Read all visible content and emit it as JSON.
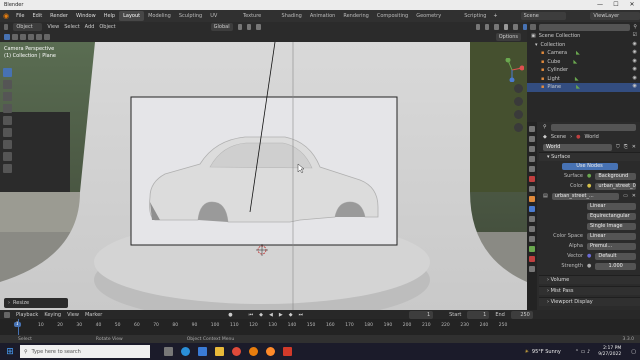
{
  "window": {
    "title": "Blender",
    "min": "—",
    "max": "☐",
    "close": "✕"
  },
  "menubar": {
    "menus": [
      "File",
      "Edit",
      "Render",
      "Window",
      "Help"
    ],
    "workspaces": [
      "Layout",
      "Modeling",
      "Sculpting",
      "UV Editing",
      "Texture Paint",
      "Shading",
      "Animation",
      "Rendering",
      "Compositing",
      "Geometry Nodes",
      "Scripting"
    ],
    "active_workspace": "Layout",
    "scene": "Scene",
    "view_layer": "ViewLayer"
  },
  "viewport_header": {
    "mode": "Object Mode",
    "menus": [
      "View",
      "Select",
      "Add",
      "Object"
    ],
    "orientation": "Global",
    "options": "Options"
  },
  "viewport": {
    "camera_label": "Camera Perspective",
    "collection_label": "(1) Collection | Plane",
    "resize_label": "Resize"
  },
  "outliner": {
    "search_placeholder": "",
    "items": [
      {
        "label": "Scene Collection",
        "color": "#cccccc"
      },
      {
        "label": "Collection",
        "color": "#cccccc"
      },
      {
        "label": "Camera",
        "color": "#e08a3c"
      },
      {
        "label": "Cube",
        "color": "#e08a3c"
      },
      {
        "label": "Cylinder",
        "color": "#e08a3c"
      },
      {
        "label": "Light",
        "color": "#e08a3c"
      },
      {
        "label": "Plane",
        "color": "#e08a3c"
      }
    ]
  },
  "properties": {
    "breadcrumb_scene": "Scene",
    "breadcrumb_world": "World",
    "world_name": "World",
    "surface_section": "Surface",
    "use_nodes": "Use Nodes",
    "surface_label": "Surface",
    "surface_value": "Background",
    "color_label": "Color",
    "color_value": "urban_street_0...",
    "image_name": "urban_street_...",
    "interp": "Linear",
    "projection": "Equirectangular",
    "single_image": "Single Image",
    "colorspace_label": "Color Space",
    "colorspace_value": "Linear",
    "alpha_label": "Alpha",
    "alpha_value": "Premul...",
    "vector_label": "Vector",
    "vector_value": "Default",
    "strength_label": "Strength",
    "strength_value": "1.000",
    "sections": [
      "Volume",
      "Mist Pass",
      "Viewport Display"
    ]
  },
  "timeline": {
    "menus": [
      "Playback",
      "Keying",
      "View",
      "Marker"
    ],
    "current_frame": "1",
    "start_label": "Start",
    "start": "1",
    "end_label": "End",
    "end": "250",
    "ticks": [
      "10",
      "20",
      "30",
      "40",
      "50",
      "60",
      "70",
      "80",
      "90",
      "100",
      "110",
      "120",
      "130",
      "140",
      "150",
      "160",
      "170",
      "180",
      "190",
      "200",
      "210",
      "220",
      "230",
      "240",
      "250"
    ],
    "frame_marker": "1"
  },
  "statusbar": {
    "items": [
      "Select",
      "Rotate View",
      "Object Context Menu"
    ],
    "version": "3.3.0"
  },
  "taskbar": {
    "search": "Type here to search",
    "weather": "95°F Sunny",
    "time": "2:17 PM",
    "date": "9/27/2022"
  }
}
